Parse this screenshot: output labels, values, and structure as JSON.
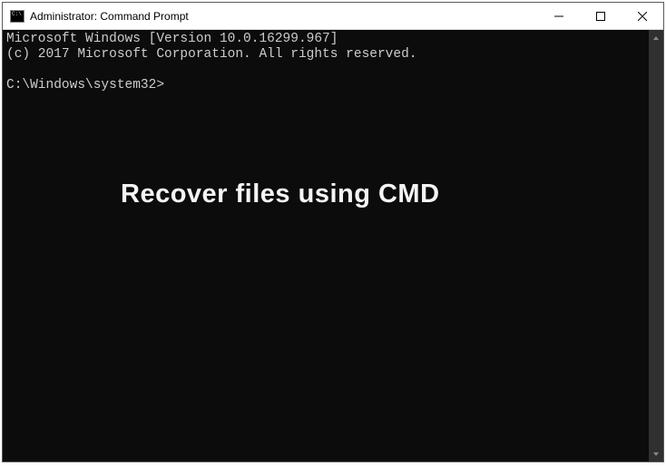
{
  "window": {
    "title": "Administrator: Command Prompt"
  },
  "terminal": {
    "line1": "Microsoft Windows [Version 10.0.16299.967]",
    "line2": "(c) 2017 Microsoft Corporation. All rights reserved.",
    "prompt": "C:\\Windows\\system32>"
  },
  "overlay": {
    "caption": "Recover files using CMD"
  }
}
